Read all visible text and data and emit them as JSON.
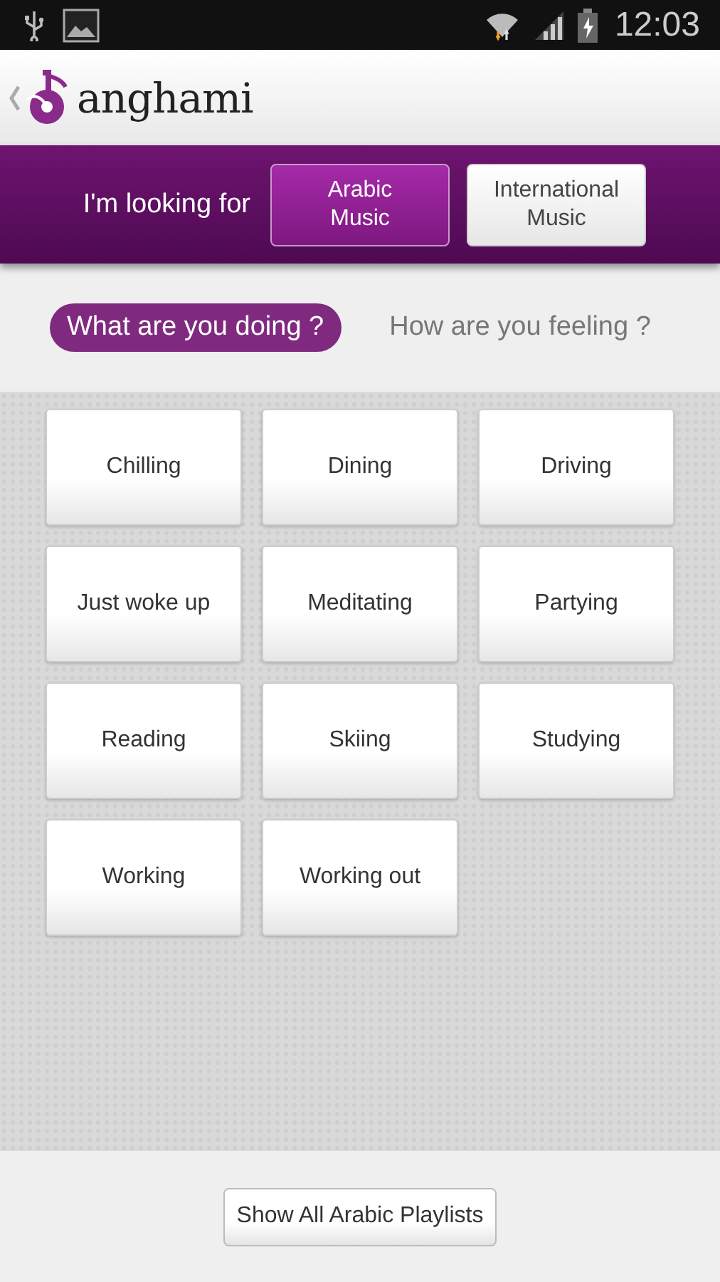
{
  "status_bar": {
    "time": "12:03"
  },
  "header": {
    "logo_text": "anghami"
  },
  "music_filter": {
    "label": "I'm looking for",
    "options": [
      {
        "label": "Arabic\nMusic",
        "selected": true
      },
      {
        "label": "International\nMusic",
        "selected": false
      }
    ]
  },
  "tabs": [
    {
      "label": "What are you doing ?",
      "selected": true
    },
    {
      "label": "How are you feeling ?",
      "selected": false
    }
  ],
  "activities": [
    "Chilling",
    "Dining",
    "Driving",
    "Just woke up",
    "Meditating",
    "Partying",
    "Reading",
    "Skiing",
    "Studying",
    "Working",
    "Working out"
  ],
  "footer_button": "Show All Arabic Playlists"
}
